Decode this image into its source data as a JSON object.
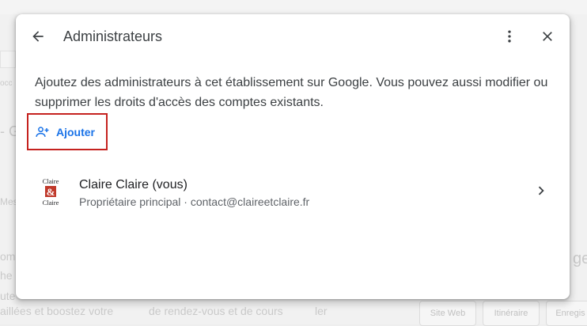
{
  "dialog": {
    "title": "Administrateurs",
    "description": "Ajoutez des administrateurs à cet établissement sur Google. Vous pouvez aussi modifier ou supprimer les droits d'accès des comptes existants.",
    "add_label": "Ajouter",
    "icons": {
      "back": "arrow-back-icon",
      "more": "more-vert-icon",
      "close": "close-icon",
      "add": "person-add-icon",
      "chevron": "chevron-right-icon"
    }
  },
  "users": [
    {
      "name": "Claire Claire (vous)",
      "detail": "Propriétaire principal · contact@claireetclaire.fr",
      "logo": {
        "top": "Claire",
        "middle": "&",
        "bottom": "Claire"
      }
    }
  ],
  "background": {
    "fragments": [
      "Mes",
      "omp",
      "he",
      "ute",
      "aillées et boostez votre",
      "de rendez-vous et de cours",
      "ler",
      "Site Web",
      "Itinéraire",
      "Enregis",
      "ge",
      "- G",
      "occ"
    ]
  },
  "colors": {
    "accent": "#1a73e8",
    "highlight_border": "#c5221f",
    "logo_red": "#c0392b"
  }
}
